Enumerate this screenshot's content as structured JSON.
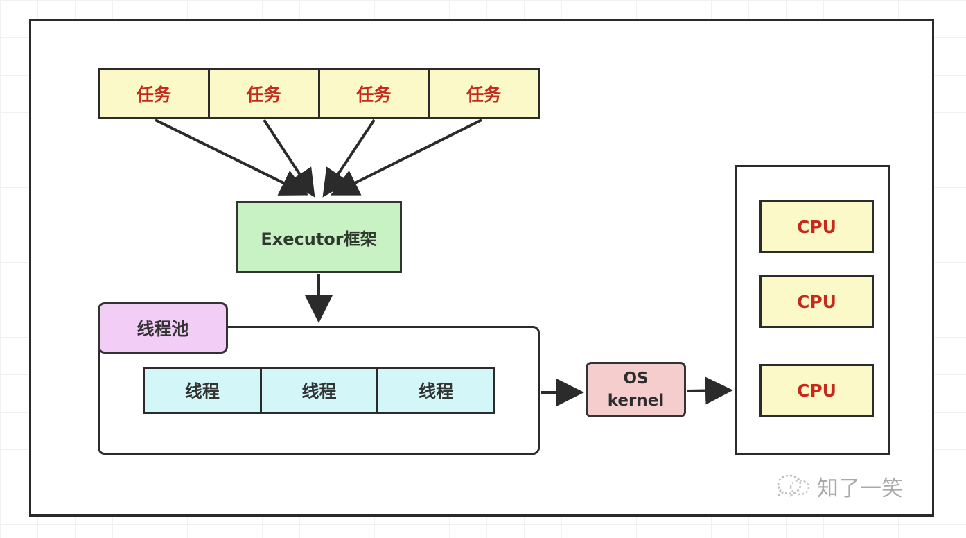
{
  "tasks": [
    "任务",
    "任务",
    "任务",
    "任务"
  ],
  "executor": "Executor框架",
  "thread_pool": {
    "label": "线程池",
    "threads": [
      "线程",
      "线程",
      "线程"
    ]
  },
  "os_kernel": {
    "line1": "OS",
    "line2": "kernel"
  },
  "cpus": [
    "CPU",
    "CPU",
    "CPU"
  ],
  "watermark": {
    "text": "知了一笑",
    "icon": "wechat-bubble-icon"
  },
  "colors": {
    "task_fill": "#fbf9c7",
    "task_text": "#c62a1c",
    "executor_fill": "#c8f2c3",
    "pool_label_fill": "#f2cdf5",
    "thread_fill": "#d3f7f8",
    "os_fill": "#f5cdcd",
    "cpu_fill": "#fbf9c7",
    "cpu_text": "#c62a1c"
  }
}
